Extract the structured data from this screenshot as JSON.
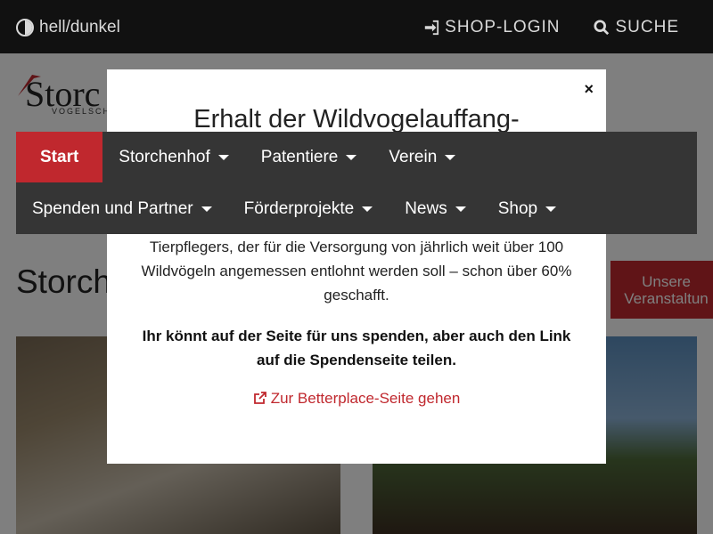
{
  "topbar": {
    "theme_toggle": "hell/dunkel",
    "shop_login": "SHOP-LOGIN",
    "search": "SUCHE"
  },
  "logo": {
    "text": "Storc",
    "subtitle": "VOGELSCH"
  },
  "nav": {
    "row1": [
      {
        "label": "Start",
        "active": true
      },
      {
        "label": "Storchenhof",
        "dropdown": true
      },
      {
        "label": "Patentiere",
        "dropdown": true
      },
      {
        "label": "Verein",
        "dropdown": true
      }
    ],
    "row2": [
      {
        "label": "Spenden und Partner",
        "dropdown": true
      },
      {
        "label": "Förderprojekte",
        "dropdown": true
      },
      {
        "label": "News",
        "dropdown": true
      },
      {
        "label": "Shop",
        "dropdown": true
      }
    ]
  },
  "main": {
    "heading": "Storch",
    "event_button": "Unsere Veranstaltun"
  },
  "modal": {
    "close": "×",
    "title": "Erhalt der Wildvogelauffang-",
    "text": "Tierpflegers, der für die Versorgung von jährlich weit über 100 Wildvögeln angemessen entlohnt werden soll – schon über 60% geschafft.",
    "bold_text": "Ihr könnt auf der Seite für uns spenden, aber auch den Link auf die Spendenseite teilen.",
    "link": "Zur Betterplace-Seite gehen"
  },
  "colors": {
    "accent": "#c0282e",
    "topbar": "#111111",
    "nav": "#353535"
  }
}
